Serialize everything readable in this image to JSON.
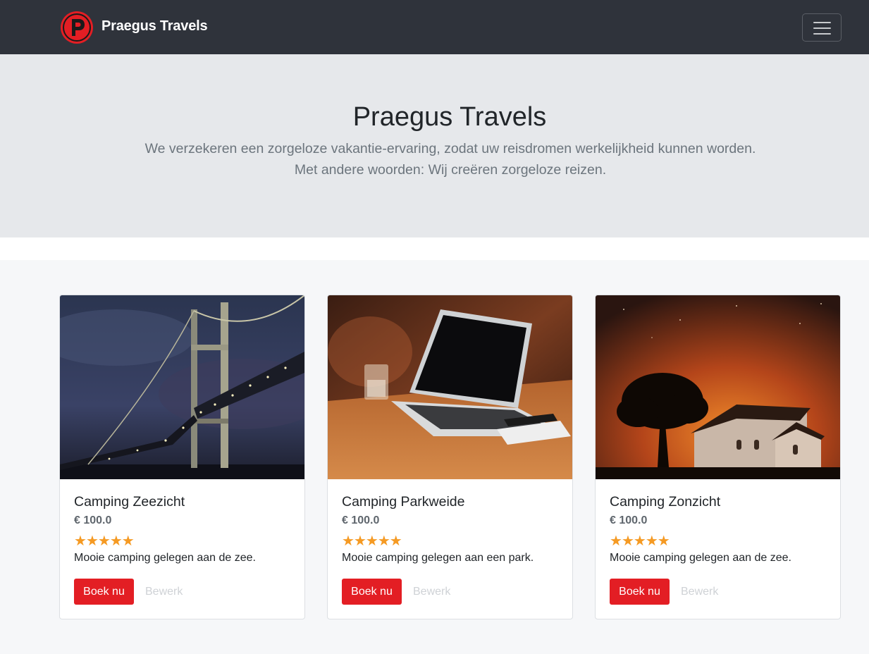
{
  "navbar": {
    "brand": "Praegus Travels",
    "logo_letter": "P",
    "toggle_icon": "hamburger-icon"
  },
  "hero": {
    "title": "Praegus Travels",
    "line1": "We verzekeren een zorgeloze vakantie-ervaring, zodat uw reisdromen werkelijkheid kunnen worden.",
    "line2": "Met andere woorden: Wij creëren zorgeloze reizen."
  },
  "cards": [
    {
      "title": "Camping Zeezicht",
      "price": "€ 100.0",
      "rating": 5,
      "description": "Mooie camping gelegen aan de zee.",
      "book_label": "Boek nu",
      "edit_label": "Bewerk",
      "image": "bridge-at-night"
    },
    {
      "title": "Camping Parkweide",
      "price": "€ 100.0",
      "rating": 5,
      "description": "Mooie camping gelegen aan een park.",
      "book_label": "Boek nu",
      "edit_label": "Bewerk",
      "image": "laptop-on-table"
    },
    {
      "title": "Camping Zonzicht",
      "price": "€ 100.0",
      "rating": 5,
      "description": "Mooie camping gelegen aan de zee.",
      "book_label": "Boek nu",
      "edit_label": "Bewerk",
      "image": "church-at-sunset"
    }
  ],
  "colors": {
    "navbar_bg": "#2f333b",
    "brand_red": "#e31e24",
    "hero_bg": "#e6e8eb",
    "star": "#f59a23"
  }
}
